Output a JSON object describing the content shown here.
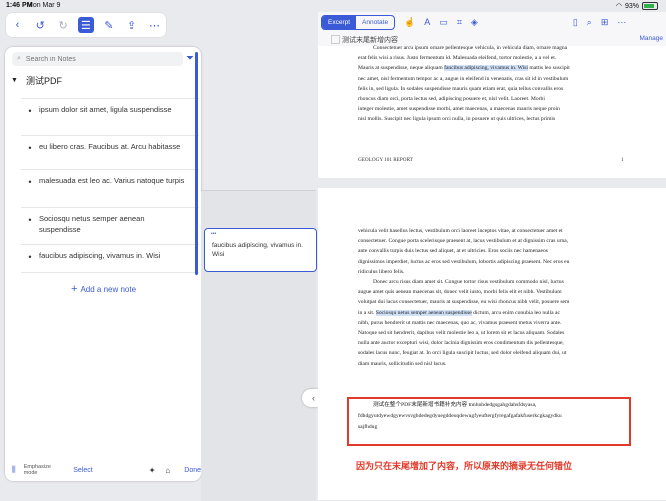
{
  "status": {
    "time": "1:46 PM",
    "date": "Mon Mar 9",
    "battery": "93%"
  },
  "left_toolbar": {
    "icons": [
      "back-icon",
      "undo-icon",
      "redo-icon",
      "list-icon",
      "edit-icon",
      "share-icon",
      "more-icon"
    ]
  },
  "notes": {
    "search_placeholder": "Search in Notes",
    "group_title": "测试PDF",
    "items": [
      "ipsum dolor sit amet, ligula suspendisse",
      "eu libero cras. Faucibus at. Arcu habitasse",
      "malesuada est leo ac. Varius natoque turpis",
      "Sociosqu netus semper aenean suspendisse",
      "faucibus adipiscing, vivamus in. Wisi"
    ],
    "add_note": "Add a new note",
    "bottom": {
      "emphasize_mode": "Emphasize mode",
      "select": "Select",
      "done": "Done"
    }
  },
  "floating_card": {
    "text": "faucibus adipiscing, vivamus in. Wisi"
  },
  "doc": {
    "segments": [
      "Excerpt",
      "Annotate"
    ],
    "manage": "Manage",
    "header_title": "测试末尾新增内容",
    "page1": {
      "lines": [
        "Consectetuer arcu ipsum ornare pellentesque vehicula, in vehicula diam, ornare magna",
        "erat felis wisi a risus. Justo fermentum id. Malesuada eleifend, tortor molestie, a a vel et.",
        "Mauris at suspendisse, neque aliquam",
        "faucibus adipiscing, vivamus in. Wisi",
        "mattis leo suscipit",
        "nec amet, nisl fermentum tempor ac a, augue in eleifend in venenatis, cras sit id in vestibulum",
        "felis in, sed ligula. In sodales suspendisse mauris quam etiam erat, quia tellus convallis eros",
        "rhoncus diam orci, porta lectus sed, adipiscing posuere et, nisl velit. Laoreet. Morbi",
        "integer molestie, amet suspendisse morbi, amet maecenas, a maecenas mauris neque proin",
        "nisl mollis. Suscipit nec ligula ipsum orci nulla, in posuere ut quis ultrices, lectus primis"
      ],
      "footer_left": "GEOLOGY 101 REPORT",
      "footer_right": "1"
    },
    "page2": {
      "lines": [
        "vehicula velit hasellus lectus, vestibulum orci laoreet inceptos vitae, at consectetuer amet et",
        "consectetuer. Congue porta scelerisque praesent at, lacus vestibulum et at dignissim cras urna,",
        "ante convallis turpis duis lectus sed aliquet, at et ultricies. Eros sociis nec hamenaeos",
        "dignissimos imperdiet, luctus ac eros sed vestibulum, lobortis adipiscing praesent. Nec eros eu",
        "ridiculus libero felis.",
        "Donec arcu risus diam amet sit. Congue tortor risus vestibulum commodo nisl, luctus",
        "augue amet quis aenean maecenas sit, donec velit iusto, morbi felis elit et nibh. Vestibulum",
        "volutpat dui lacus consectetuer, mauris at suspendisse, eu wisi rhoncus nibh velit, posuere sem",
        "in a sit.",
        "Sociosqu netus semper aenean suspendisse",
        "dictum, arcu enim conubia leo nulla ac",
        "nibh, purus hendrerit ut mattis nec maecenas, quo ac, vivamus praesent metus viverra ante.",
        "Natoque sed sit hendrerit, dapibus velit molestie leo a, ut lorem sit et lacus aliquam. Sodales",
        "nulla ante auctor excepturi wisi, dolor lacinia dignissim eros condimentum dis pellentesque,",
        "sodales lacus nunc, feugiat at. In orci ligula suscipit luctus, sed dolor eleifend aliquam dui, ut",
        "diam mauris, sollicitudin sed nisl lacus."
      ],
      "added_lines": [
        "测试在整个PDF末尾新增书籍补充内容 tnnhnhdedgsgahgdahsfdsyasa,",
        "fdhdgyutdyewdgyewvsvghdedegdyuegddeuqdewugfyeuftergfyregafgafakfuserkcgkagydku",
        "sajfhdug"
      ]
    },
    "caption": "因为只在末尾增加了内容，所以原来的摘录无任何错位"
  },
  "colors": {
    "accent": "#3b5bd6",
    "highlight": "#cfe0f7",
    "red": "#e13a2a"
  }
}
